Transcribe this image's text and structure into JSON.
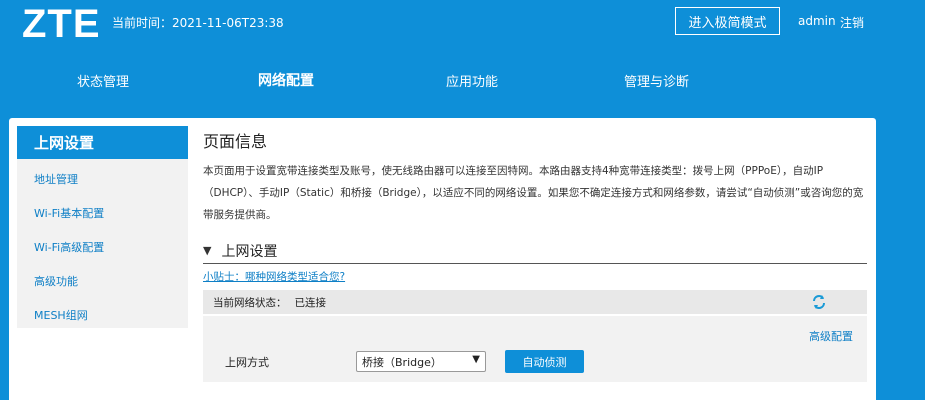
{
  "header": {
    "logo": "ZTE",
    "current_time": "当前时间：2021-11-06T23:38",
    "quick_mode_label": "进入极简模式",
    "user": "admin",
    "logout": "注销"
  },
  "nav": {
    "items": [
      {
        "label": "状态管理"
      },
      {
        "label": "网络配置"
      },
      {
        "label": "应用功能"
      },
      {
        "label": "管理与诊断"
      }
    ],
    "active": "网络配置"
  },
  "sidebar": {
    "title": "上网设置",
    "items": [
      {
        "label": "地址管理"
      },
      {
        "label": "Wi-Fi基本配置"
      },
      {
        "label": "Wi-Fi高级配置"
      },
      {
        "label": "高级功能"
      },
      {
        "label": "MESH组网"
      }
    ]
  },
  "main": {
    "page_heading": "页面信息",
    "page_desc": "本页面用于设置宽带连接类型及账号，使无线路由器可以连接至因特网。本路由器支持4种宽带连接类型：拨号上网（PPPoE），自动IP（DHCP）、手动IP（Static）和桥接（Bridge），以适应不同的网络设置。如果您不确定连接方式和网络参数，请尝试“自动侦测”或咨询您的宽带服务提供商。",
    "section_title": "上网设置",
    "tip_link": "小贴士：哪种网络类型适合您?",
    "status_label": "当前网络状态：",
    "status_value": "已连接",
    "advanced_link": "高级配置",
    "mode_label": "上网方式",
    "mode_value": "桥接（Bridge）",
    "detect_button": "自动侦测"
  },
  "colors": {
    "brand_blue": "#0e8fd8",
    "link_blue": "#0e7fc6"
  }
}
